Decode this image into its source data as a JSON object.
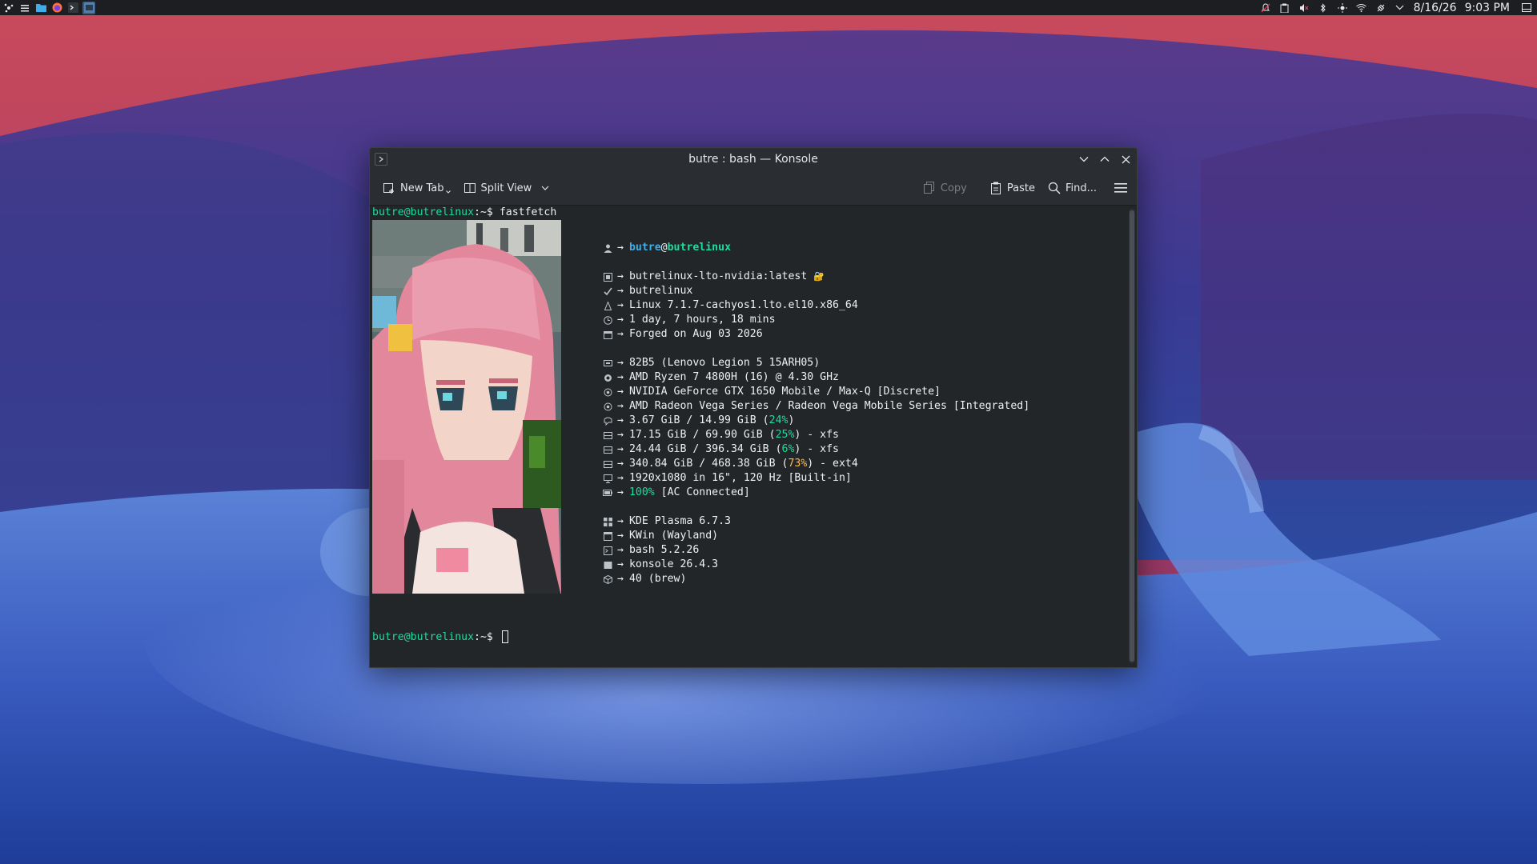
{
  "panel": {
    "tasks": [
      {
        "name": "app-launcher-icon",
        "active": false
      },
      {
        "name": "system-settings-icon",
        "active": false
      },
      {
        "name": "file-manager-icon",
        "active": false
      },
      {
        "name": "firefox-icon",
        "active": false
      },
      {
        "name": "konsole-task-icon",
        "active": false
      },
      {
        "name": "konsole-window-icon",
        "active": true
      }
    ],
    "tray": [
      "notifications-off-icon",
      "clipboard-icon",
      "volume-muted-icon",
      "bluetooth-icon",
      "brightness-icon",
      "wifi-icon",
      "power-icon",
      "chevron-down-icon"
    ],
    "clock": {
      "date": "8/16/26",
      "time": "9:03 PM"
    }
  },
  "window": {
    "title": "butre : bash — Konsole",
    "toolbar": {
      "new_tab": "New Tab",
      "split_view": "Split View",
      "copy": "Copy",
      "paste": "Paste",
      "find": "Find..."
    }
  },
  "terminal": {
    "prompt_user": "butre@butrelinux",
    "prompt_suffix": ":~$ ",
    "command": "fastfetch",
    "info": {
      "user": "butre",
      "at": "@",
      "host": "butrelinux",
      "image": "butrelinux-lto-nvidia:latest",
      "lock_glyph": "🔐",
      "hostname": "butrelinux",
      "kernel": "Linux 7.1.7-cachyos1.lto.el10.x86_64",
      "uptime": "1 day, 7 hours, 18 mins",
      "forged": "Forged on Aug 03 2026",
      "model": "82B5 (Lenovo Legion 5 15ARH05)",
      "cpu": "AMD Ryzen 7 4800H (16) @ 4.30 GHz",
      "gpu1": "NVIDIA GeForce GTX 1650 Mobile / Max-Q [Discrete]",
      "gpu2": "AMD Radeon Vega Series / Radeon Vega Mobile Series [Integrated]",
      "memory": {
        "used": "3.67 GiB / 14.99 GiB (",
        "pct": "24%",
        "tail": ")"
      },
      "disk1": {
        "used": "17.15 GiB / 69.90 GiB (",
        "pct": "25%",
        "tail": ") - xfs"
      },
      "disk2": {
        "used": "24.44 GiB / 396.34 GiB (",
        "pct": "6%",
        "tail": ") - xfs"
      },
      "disk3": {
        "used": "340.84 GiB / 468.38 GiB (",
        "pct": "73%",
        "tail": ") - ext4"
      },
      "display": "1920x1080 in 16\", 120 Hz [Built-in]",
      "battery": {
        "pct": "100%",
        "tail": " [AC Connected]"
      },
      "de": "KDE Plasma 6.7.3",
      "wm": "KWin (Wayland)",
      "shell": "bash 5.2.26",
      "terminal": "konsole 26.4.3",
      "packages": "40 (brew)"
    },
    "palette_top": [
      "#232629",
      "#ed1515",
      "#11d116",
      "#f67400",
      "#1d99f3",
      "#9b59b6",
      "#1abc9c",
      "#fcfcfc"
    ],
    "palette_bottom": [
      "#7f8c8d",
      "#c0392b",
      "#1cdc9a",
      "#fdbc4b",
      "#3daee9",
      "#8e44ad",
      "#16a085",
      "#ffffff"
    ]
  }
}
